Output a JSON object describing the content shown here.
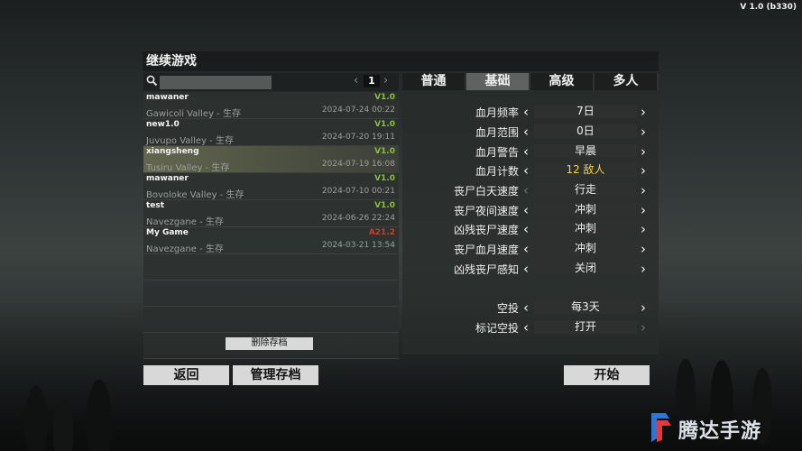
{
  "version": "V 1.0 (b330)",
  "window_title": "继续游戏",
  "left_panel": {
    "search_placeholder": "",
    "page_prev": "‹",
    "page_number": "1",
    "page_next": "›",
    "saves": [
      {
        "name": "mawaner",
        "version": "V1.0",
        "world": "Gawicoli Valley - 生存",
        "date": "2024-07-24 00:22",
        "selected": false,
        "version_color": "green"
      },
      {
        "name": "new1.0",
        "version": "V1.0",
        "world": "Juvupo Valley - 生存",
        "date": "2024-07-20 19:11",
        "selected": false,
        "version_color": "green"
      },
      {
        "name": "xiangsheng",
        "version": "V1.0",
        "world": "Tusiru Valley - 生存",
        "date": "2024-07-19 16:08",
        "selected": true,
        "version_color": "green"
      },
      {
        "name": "mawaner",
        "version": "V1.0",
        "world": "Bovoloke Valley - 生存",
        "date": "2024-07-10 00:21",
        "selected": false,
        "version_color": "green"
      },
      {
        "name": "test",
        "version": "V1.0",
        "world": "Navezgane - 生存",
        "date": "2024-06-26 22:24",
        "selected": false,
        "version_color": "green"
      },
      {
        "name": "My Game",
        "version": "A21.2",
        "world": "Navezgane - 生存",
        "date": "2024-03-21 13:54",
        "selected": false,
        "version_color": "red"
      }
    ],
    "delete_label": "删除存档"
  },
  "right_panel": {
    "tabs": [
      "普通",
      "基础",
      "高级",
      "多人"
    ],
    "active_tab": 1,
    "settings": [
      {
        "label": "血月频率",
        "value": "7日",
        "highlight": false,
        "left_dim": false,
        "right_dim": false
      },
      {
        "label": "血月范围",
        "value": "0日",
        "highlight": false,
        "left_dim": false,
        "right_dim": false
      },
      {
        "label": "血月警告",
        "value": "早晨",
        "highlight": false,
        "left_dim": false,
        "right_dim": false
      },
      {
        "label": "血月计数",
        "value": "12 敌人",
        "highlight": true,
        "left_dim": false,
        "right_dim": false
      },
      {
        "label": "丧尸白天速度",
        "value": "行走",
        "highlight": false,
        "left_dim": true,
        "right_dim": false
      },
      {
        "label": "丧尸夜间速度",
        "value": "冲刺",
        "highlight": false,
        "left_dim": false,
        "right_dim": false
      },
      {
        "label": "凶残丧尸速度",
        "value": "冲刺",
        "highlight": false,
        "left_dim": false,
        "right_dim": false
      },
      {
        "label": "丧尸血月速度",
        "value": "冲刺",
        "highlight": false,
        "left_dim": false,
        "right_dim": false
      },
      {
        "label": "凶残丧尸感知",
        "value": "关闭",
        "highlight": false,
        "left_dim": false,
        "right_dim": false
      },
      {
        "label": "空投",
        "value": "每3天",
        "highlight": false,
        "left_dim": false,
        "right_dim": false
      },
      {
        "label": "标记空投",
        "value": "打开",
        "highlight": false,
        "left_dim": false,
        "right_dim": true
      }
    ]
  },
  "buttons": {
    "back": "返回",
    "manage": "管理存档",
    "start": "开始"
  },
  "watermark": {
    "text": "腾达手游"
  },
  "colors": {
    "version_green": "#8abf3a",
    "version_red": "#d23b2b",
    "highlight_yellow": "#f0d24a",
    "button_bg": "#d8d8d8"
  }
}
